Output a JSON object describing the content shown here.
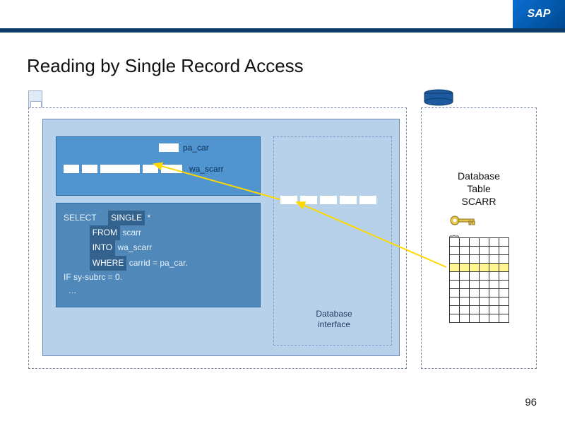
{
  "header": {
    "brand": "SAP"
  },
  "title": "Reading by Single Record Access",
  "page_number": "96",
  "program": {
    "pa_label": "pa_car",
    "wa_label": "wa_scarr",
    "code": {
      "select": "SELECT",
      "single": "SINGLE",
      "star": "*",
      "from_kw": "FROM",
      "from_tbl": "scarr",
      "into_kw": "INTO",
      "into_wa": "wa_scarr",
      "where_kw": "WHERE",
      "where_cond": "carrid = pa_car.",
      "ifline": "IF sy-subrc = 0.",
      "ellipsis": "…"
    }
  },
  "interface_label_l1": "Database",
  "interface_label_l2": "interface",
  "db_title_l1": "Database",
  "db_title_l2": "Table",
  "db_title_l3": "SCARR"
}
